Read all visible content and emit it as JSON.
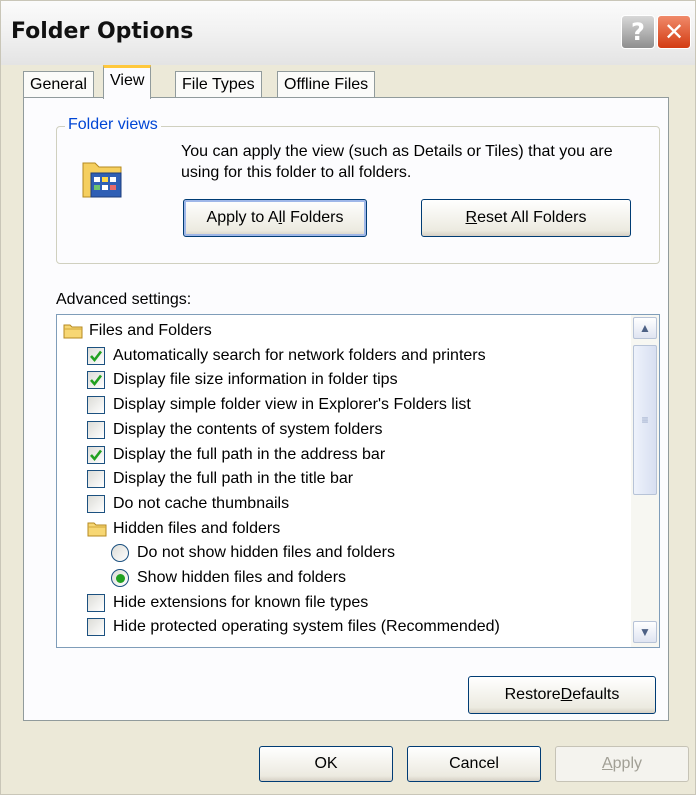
{
  "window": {
    "title": "Folder Options"
  },
  "tabs": [
    {
      "label": "General",
      "active": false
    },
    {
      "label": "View",
      "active": true
    },
    {
      "label": "File Types",
      "active": false
    },
    {
      "label": "Offline Files",
      "active": false
    }
  ],
  "folder_views": {
    "legend": "Folder views",
    "description": "You can apply the view (such as Details or Tiles) that you are using for this folder to all folders.",
    "apply_all_label_pre": "Apply to A",
    "apply_all_label_u": "l",
    "apply_all_label_post": "l Folders",
    "reset_all_label_u": "R",
    "reset_all_label_post": "eset All Folders"
  },
  "advanced": {
    "label": "Advanced settings:",
    "items": [
      {
        "type": "folder",
        "label": "Files and Folders",
        "indent": 0
      },
      {
        "type": "checkbox",
        "label": "Automatically search for network folders and printers",
        "checked": true,
        "indent": 1
      },
      {
        "type": "checkbox",
        "label": "Display file size information in folder tips",
        "checked": true,
        "indent": 1
      },
      {
        "type": "checkbox",
        "label": "Display simple folder view in Explorer's Folders list",
        "checked": false,
        "indent": 1
      },
      {
        "type": "checkbox",
        "label": "Display the contents of system folders",
        "checked": false,
        "indent": 1
      },
      {
        "type": "checkbox",
        "label": "Display the full path in the address bar",
        "checked": true,
        "indent": 1
      },
      {
        "type": "checkbox",
        "label": "Display the full path in the title bar",
        "checked": false,
        "indent": 1
      },
      {
        "type": "checkbox",
        "label": "Do not cache thumbnails",
        "checked": false,
        "indent": 1
      },
      {
        "type": "folder",
        "label": "Hidden files and folders",
        "indent": 1
      },
      {
        "type": "radio",
        "label": "Do not show hidden files and folders",
        "checked": false,
        "indent": 2
      },
      {
        "type": "radio",
        "label": "Show hidden files and folders",
        "checked": true,
        "indent": 2
      },
      {
        "type": "checkbox",
        "label": "Hide extensions for known file types",
        "checked": false,
        "indent": 1
      },
      {
        "type": "checkbox",
        "label": "Hide protected operating system files (Recommended)",
        "checked": false,
        "indent": 1
      }
    ]
  },
  "restore_defaults": {
    "pre": "Restore ",
    "u": "D",
    "post": "efaults"
  },
  "footer": {
    "ok_label": "OK",
    "cancel_label": "Cancel",
    "apply_u": "A",
    "apply_post": "pply"
  },
  "colors": {
    "window_bg": "#ece9d8",
    "accent_blue": "#0046d5",
    "check_green": "#21a121",
    "active_tab_highlight": "#ffc83c"
  }
}
